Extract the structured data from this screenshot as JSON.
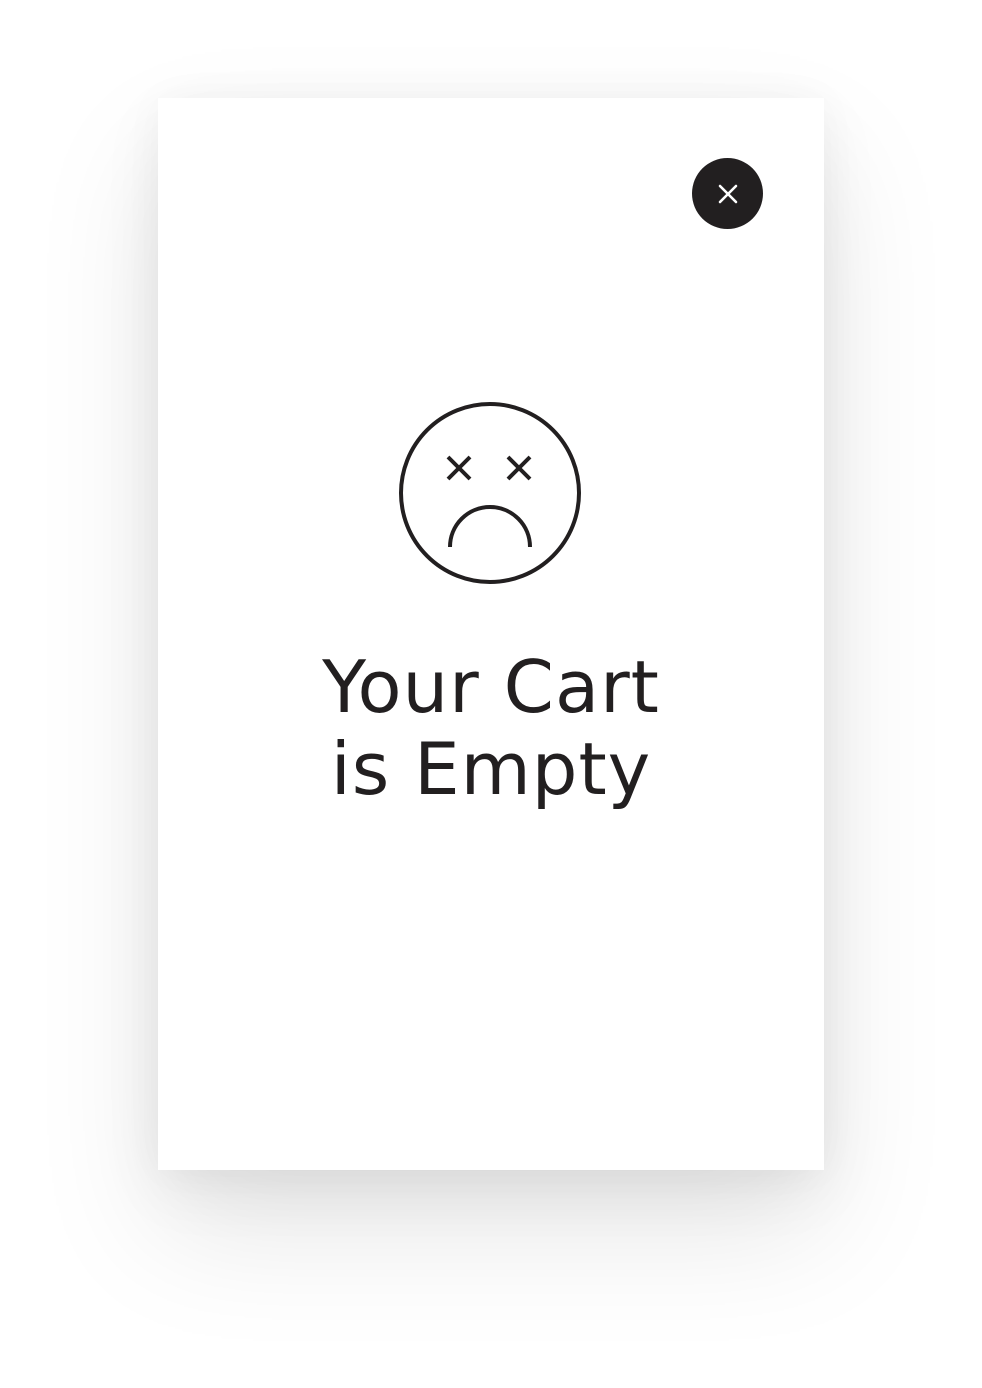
{
  "cart": {
    "title_line1": "Your Cart",
    "title_line2": "is Empty"
  },
  "icons": {
    "close": "close-icon",
    "empty_state": "sad-face-icon"
  },
  "colors": {
    "ink": "#221f20",
    "background": "#ffffff"
  }
}
